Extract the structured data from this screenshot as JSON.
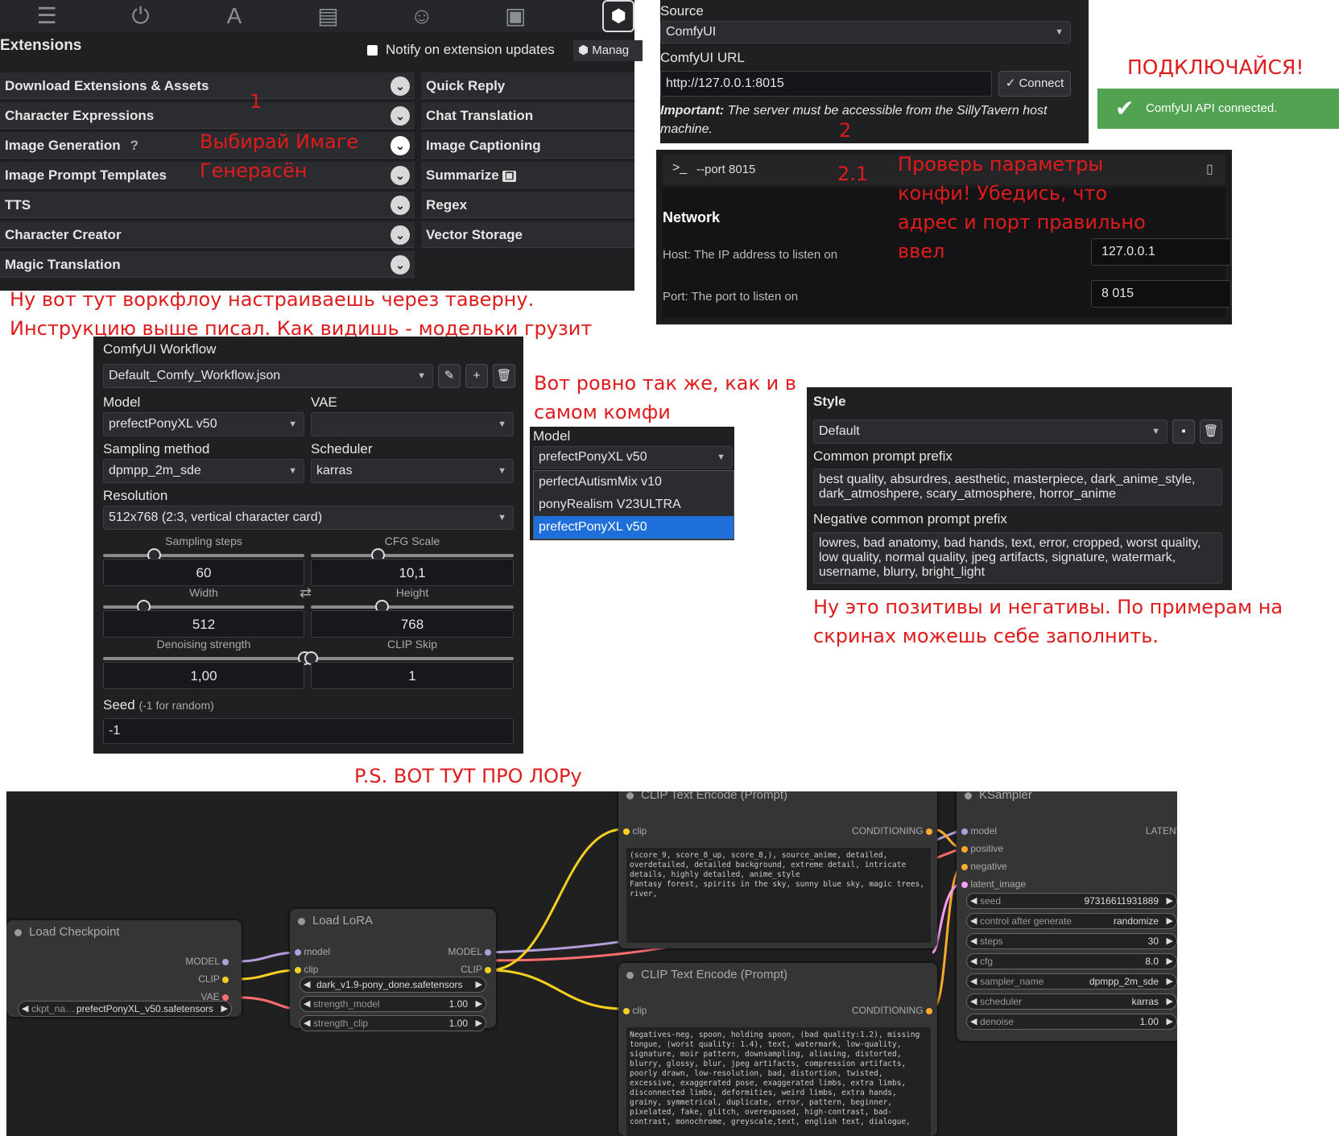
{
  "extensions": {
    "top_icons": [
      "sliders-icon",
      "plug-icon",
      "font-icon",
      "book-globe-icon",
      "user-gear-icon",
      "image-icon",
      "cubes-icon"
    ],
    "title": "Extensions",
    "notify_label": "Notify on extension updates",
    "manage_label": "Manag",
    "left_items": [
      "Download Extensions & Assets",
      "Character Expressions",
      "Image Generation",
      "Image Prompt Templates",
      "TTS",
      "Character Creator",
      "Magic Translation"
    ],
    "help_mark": "?",
    "right_items": [
      "Quick Reply",
      "Chat Translation",
      "Image Captioning",
      "Summarize",
      "Regex",
      "Vector Storage"
    ]
  },
  "source": {
    "source_label": "Source",
    "source_value": "ComfyUI",
    "url_label": "ComfyUI URL",
    "url_value": "http://127.0.0.1:8015",
    "connect_label": "Connect",
    "important_bold": "Important:",
    "important_text": "The server must be accessible from the SillyTavern host machine."
  },
  "toast": {
    "text": "ComfyUI API connected."
  },
  "comfy_settings": {
    "command": "--port 8015",
    "prompt_symbol": ">_",
    "network_title": "Network",
    "host_label": "Host: The IP address to listen on",
    "host_value": "127.0.0.1",
    "port_label": "Port: The port to listen on",
    "port_value": "8 015"
  },
  "workflow": {
    "title": "ComfyUI Workflow",
    "workflow_value": "Default_Comfy_Workflow.json",
    "model_label": "Model",
    "model_value": "prefectPonyXL v50",
    "vae_label": "VAE",
    "vae_value": "",
    "sampling_label": "Sampling method",
    "sampling_value": "dpmpp_2m_sde",
    "scheduler_label": "Scheduler",
    "scheduler_value": "karras",
    "resolution_label": "Resolution",
    "resolution_value": "512x768 (2:3, vertical character card)",
    "steps_label": "Sampling steps",
    "steps_value": "60",
    "cfg_label": "CFG Scale",
    "cfg_value": "10,1",
    "width_label": "Width",
    "width_value": "512",
    "height_label": "Height",
    "height_value": "768",
    "denoise_label": "Denoising strength",
    "denoise_value": "1,00",
    "clipskip_label": "CLIP Skip",
    "clipskip_value": "1",
    "seed_label": "Seed",
    "seed_hint": "(-1 for random)",
    "seed_value": "-1",
    "slider_levels": {
      "steps": 0.25,
      "cfg": 0.33,
      "width": 0.2,
      "height": 0.35,
      "denoise": 1.0,
      "clipskip": 0.0
    }
  },
  "model_dropdown": {
    "label": "Model",
    "value": "prefectPonyXL v50",
    "options": [
      "perfectAutismMix v10",
      "ponyRealism V23ULTRA",
      "prefectPonyXL v50"
    ],
    "selected_index": 2
  },
  "style": {
    "title": "Style",
    "value": "Default",
    "prefix_label": "Common prompt prefix",
    "prefix_value": "best quality, absurdres, aesthetic, masterpiece, dark_anime_style, dark_atmoshpere, scary_atmosphere, horror_anime",
    "neg_label": "Negative common prompt prefix",
    "neg_value": "lowres, bad anatomy, bad hands, text, error, cropped, worst quality, low quality, normal quality, jpeg artifacts, signature, watermark, username, blurry, bright_light"
  },
  "annotations": {
    "a1": "1",
    "a_choose": "Выбирай Имаге\nГенерасён",
    "a_source_num": "2",
    "a_connect": "ПОДКЛЮЧАЙСЯ!",
    "a21": "2.1",
    "a_check": "Проверь параметры\nконфи! Убедись, что\nадрес и порт правильно\nввел",
    "a_workflow": "Ну вот тут воркфлоу настраиваешь через таверну.\nИнструкцию выше писал. Как видишь - модельки грузит",
    "a_same": "Вот ровно так же, как и в\nсамом комфи",
    "a_posneg": "Ну это позитивы и негативы. По примерам на\nскринах можешь себе заполнить.",
    "a_ps": "P.S. ВОТ ТУТ ПРО ЛОРу"
  },
  "graph": {
    "checkpoint": {
      "title": "Load Checkpoint",
      "outputs": [
        "MODEL",
        "CLIP",
        "VAE"
      ],
      "ckpt_label": "ckpt_na…",
      "ckpt_value": "prefectPonyXL_v50.safetensors"
    },
    "lora": {
      "title": "Load LoRA",
      "inputs": [
        "model",
        "clip"
      ],
      "outputs": [
        "MODEL",
        "CLIP"
      ],
      "lora_value": "dark_v1.9-pony_done.safetensors",
      "strength_model_label": "strength_model",
      "strength_model": "1.00",
      "strength_clip_label": "strength_clip",
      "strength_clip": "1.00"
    },
    "clip_pos": {
      "title": "CLIP Text Encode (Prompt)",
      "input": "clip",
      "output": "CONDITIONING",
      "text": "(score_9, score_8_up, score_8,), source_anime, detailed, overdetailed, detailed background, extreme detail, intricate details, highly detailed, anime_style\nFantasy forest, spirits in the sky, sunny blue sky, magic trees, river,"
    },
    "clip_neg": {
      "title": "CLIP Text Encode (Prompt)",
      "input": "clip",
      "output": "CONDITIONING",
      "text": "Negatives-neg, spoon, holding spoon, (bad quality:1.2), missing tongue, (worst quality: 1.4), text, watermark, low-quality, signature, moir pattern, downsampling, aliasing, distorted, blurry, glossy, blur, jpeg artifacts, compression artifacts, poorly drawn, low-resolution, bad, distortion, twisted, excessive, exaggerated pose, exaggerated limbs, extra limbs, disconnected limbs, deformities, weird limbs, extra hands, grainy, symmetrical, duplicate, error, pattern, beginner, pixelated, fake, glitch, overexposed, high-contrast, bad-contrast, monochrome, greyscale,text, english text, dialogue,"
    },
    "ksampler": {
      "title": "KSampler",
      "inputs": [
        "model",
        "positive",
        "negative",
        "latent_image"
      ],
      "output": "LATENT",
      "widgets": [
        {
          "label": "seed",
          "value": "973166119318​89"
        },
        {
          "label": "control after generate",
          "value": "randomize"
        },
        {
          "label": "steps",
          "value": "30"
        },
        {
          "label": "cfg",
          "value": "8.0"
        },
        {
          "label": "sampler_name",
          "value": "dpmpp_2m_sde"
        },
        {
          "label": "scheduler",
          "value": "karras"
        },
        {
          "label": "denoise",
          "value": "1.00"
        }
      ]
    },
    "wire_colors": {
      "model": "#b39ddb",
      "clip": "#f5d020",
      "vae": "#ff6e6e",
      "conditioning": "#ffa931",
      "latent": "#ff9cf9"
    }
  }
}
